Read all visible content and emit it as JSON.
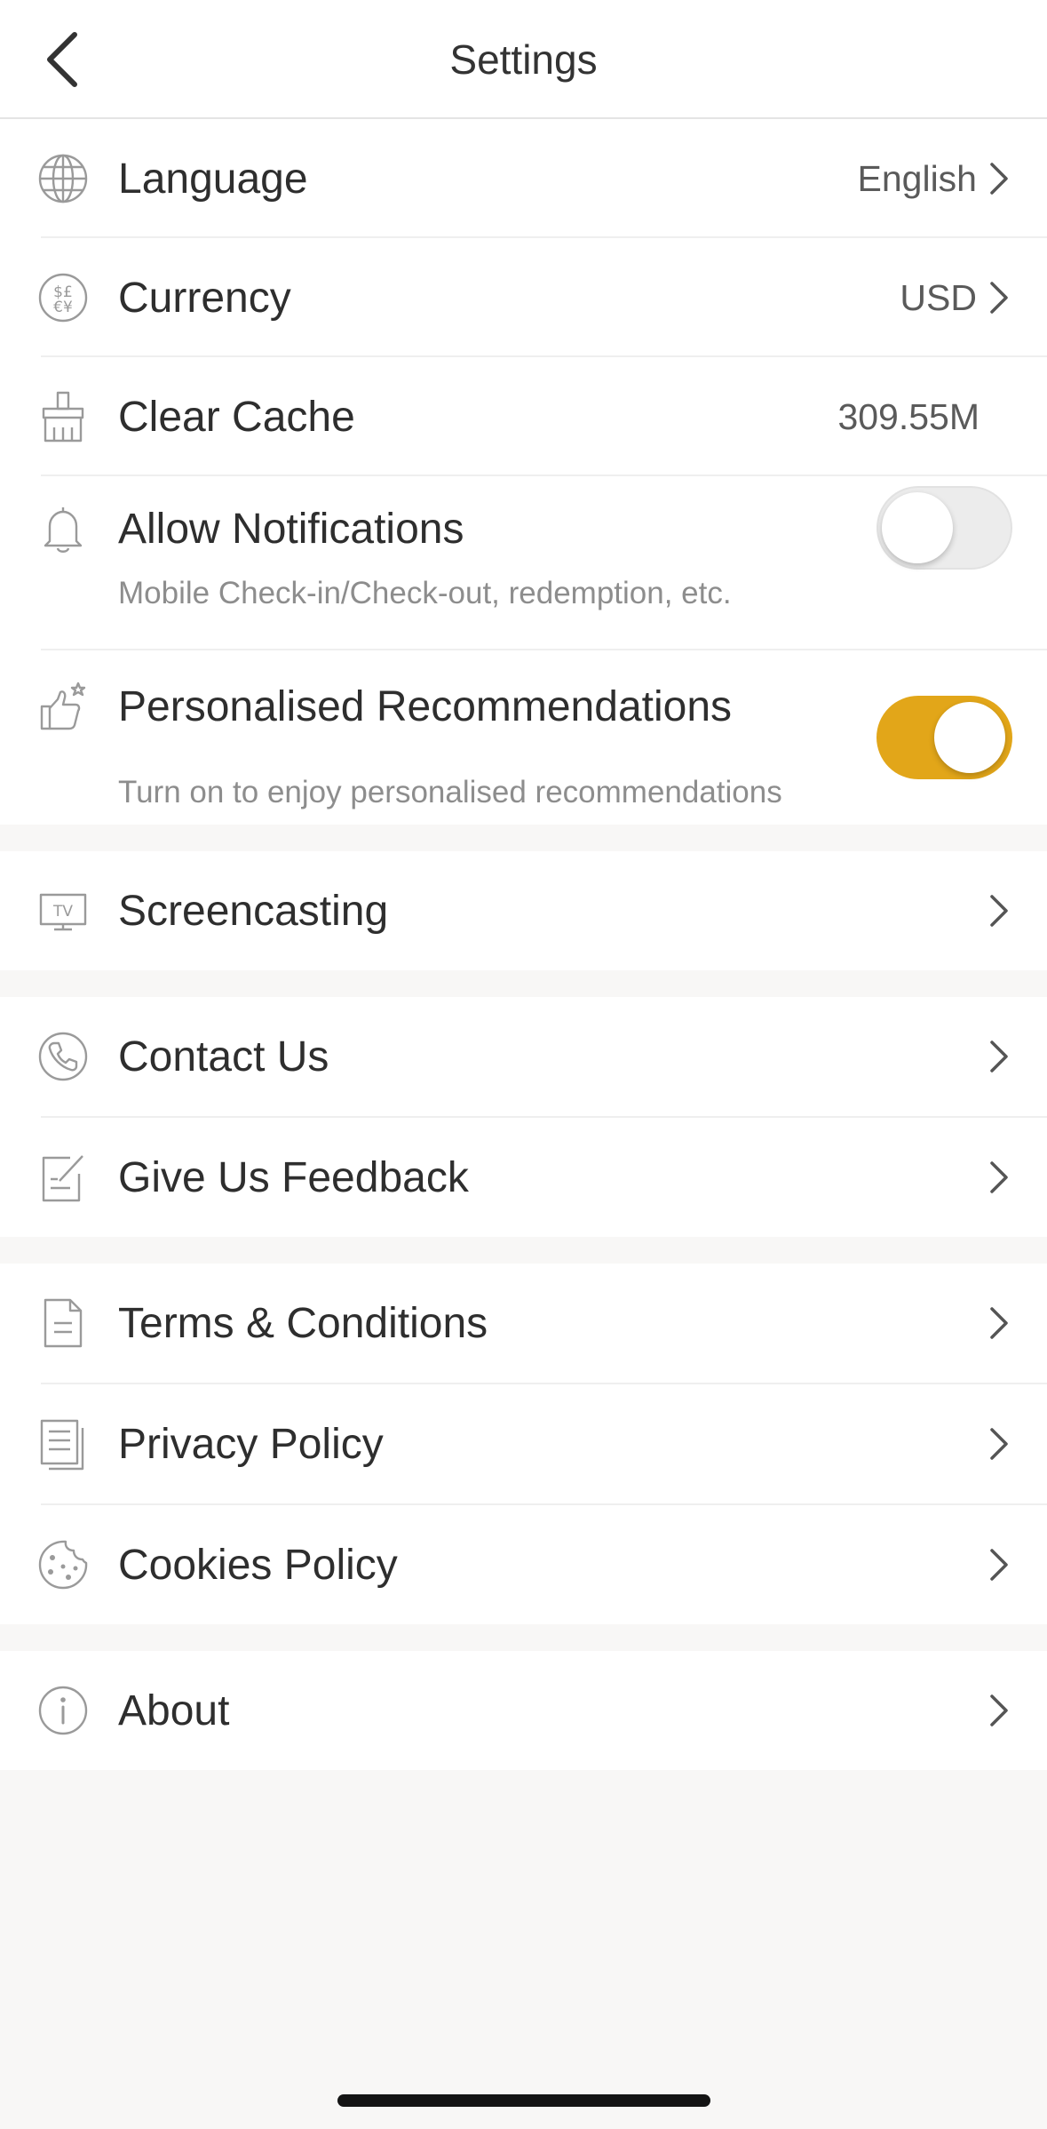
{
  "header": {
    "title": "Settings"
  },
  "settings": {
    "language": {
      "label": "Language",
      "value": "English"
    },
    "currency": {
      "label": "Currency",
      "value": "USD"
    },
    "clear_cache": {
      "label": "Clear Cache",
      "value": "309.55M"
    },
    "notifications": {
      "label": "Allow Notifications",
      "sublabel": "Mobile Check-in/Check-out, redemption, etc.",
      "enabled": false
    },
    "recommendations": {
      "label": "Personalised Recommendations",
      "sublabel": "Turn on to enjoy personalised recommendations",
      "enabled": true
    }
  },
  "screencasting": {
    "label": "Screencasting"
  },
  "support": {
    "contact": "Contact Us",
    "feedback": "Give Us Feedback"
  },
  "legal": {
    "terms": "Terms & Conditions",
    "privacy": "Privacy Policy",
    "cookies": "Cookies Policy"
  },
  "about": {
    "label": "About"
  },
  "colors": {
    "accent": "#e2a619",
    "background": "#f8f7f6",
    "icon": "#9a9a9a"
  },
  "icons": [
    "back-chevron-icon",
    "globe-icon",
    "currency-icon",
    "broom-icon",
    "bell-icon",
    "thumbs-up-star-icon",
    "tv-icon",
    "phone-icon",
    "edit-note-icon",
    "document-icon",
    "documents-icon",
    "cookie-icon",
    "info-icon",
    "chevron-right-icon"
  ]
}
